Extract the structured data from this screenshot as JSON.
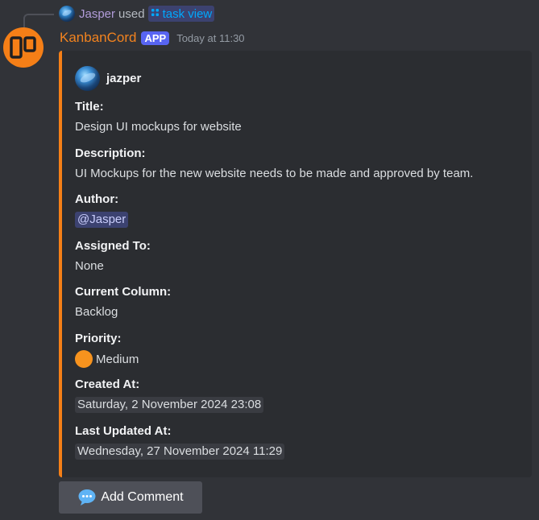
{
  "reply": {
    "user": "Jasper",
    "action": "used",
    "command": "task view"
  },
  "message": {
    "bot_name": "KanbanCord",
    "tag": "APP",
    "timestamp": "Today at 11:30"
  },
  "embed": {
    "author": "jazper",
    "accent_color": "#f57f17",
    "fields": {
      "title": {
        "name": "Title:",
        "value": "Design UI mockups for website"
      },
      "description": {
        "name": "Description:",
        "value": "UI Mockups for the new website needs to be made and approved by team."
      },
      "author": {
        "name": "Author:",
        "value": "@Jasper"
      },
      "assigned": {
        "name": "Assigned To:",
        "value": "None"
      },
      "column": {
        "name": "Current Column:",
        "value": "Backlog"
      },
      "priority": {
        "name": "Priority:",
        "value": "Medium",
        "icon": "orange-circle-icon",
        "color": "#f7931e"
      },
      "created": {
        "name": "Created At:",
        "value": "Saturday, 2 November 2024 23:08"
      },
      "updated": {
        "name": "Last Updated At:",
        "value": "Wednesday, 27 November 2024 11:29"
      }
    }
  },
  "button": {
    "label": "Add Comment",
    "icon": "speech-bubble-icon"
  }
}
